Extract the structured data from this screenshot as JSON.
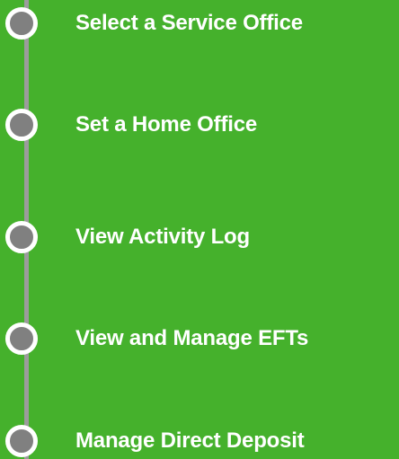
{
  "menu": {
    "items": [
      {
        "label": "Select a Service Office"
      },
      {
        "label": "Set a Home Office"
      },
      {
        "label": "View Activity Log"
      },
      {
        "label": "View and Manage EFTs"
      },
      {
        "label": "Manage Direct Deposit"
      }
    ]
  },
  "colors": {
    "background": "#45b12c",
    "track": "#9c9c9c",
    "dot_fill": "#808080",
    "dot_ring": "#ffffff",
    "text": "#ffffff"
  }
}
